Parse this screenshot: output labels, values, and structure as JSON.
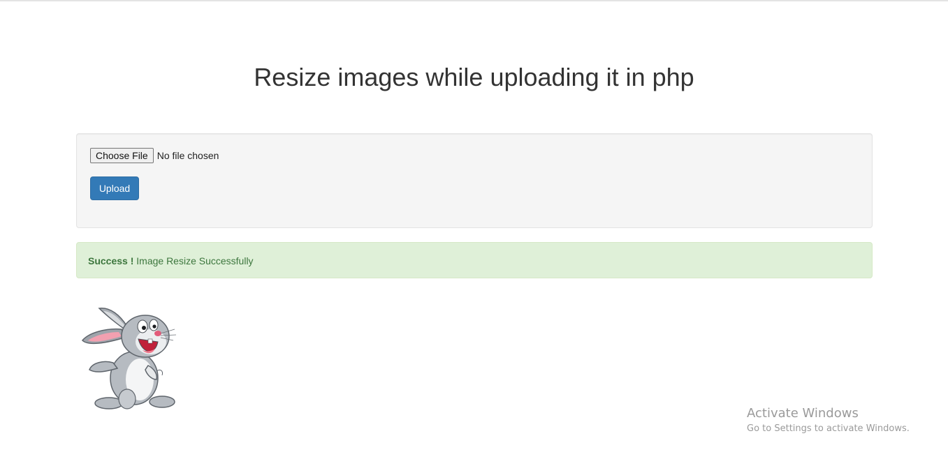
{
  "page": {
    "title": "Resize images while uploading it in php"
  },
  "form": {
    "choose_file_label": "Choose File",
    "file_status": "No file chosen",
    "upload_label": "Upload"
  },
  "alert": {
    "strong": "Success !",
    "message": "Image Resize Successfully",
    "color": "#3c763d",
    "background": "#dff0d8"
  },
  "result_image": {
    "icon": "rabbit-cartoon"
  },
  "watermark": {
    "title": "Activate Windows",
    "subtitle": "Go to Settings to activate Windows."
  },
  "colors": {
    "primary_button": "#337ab7",
    "well_background": "#f5f5f5"
  }
}
